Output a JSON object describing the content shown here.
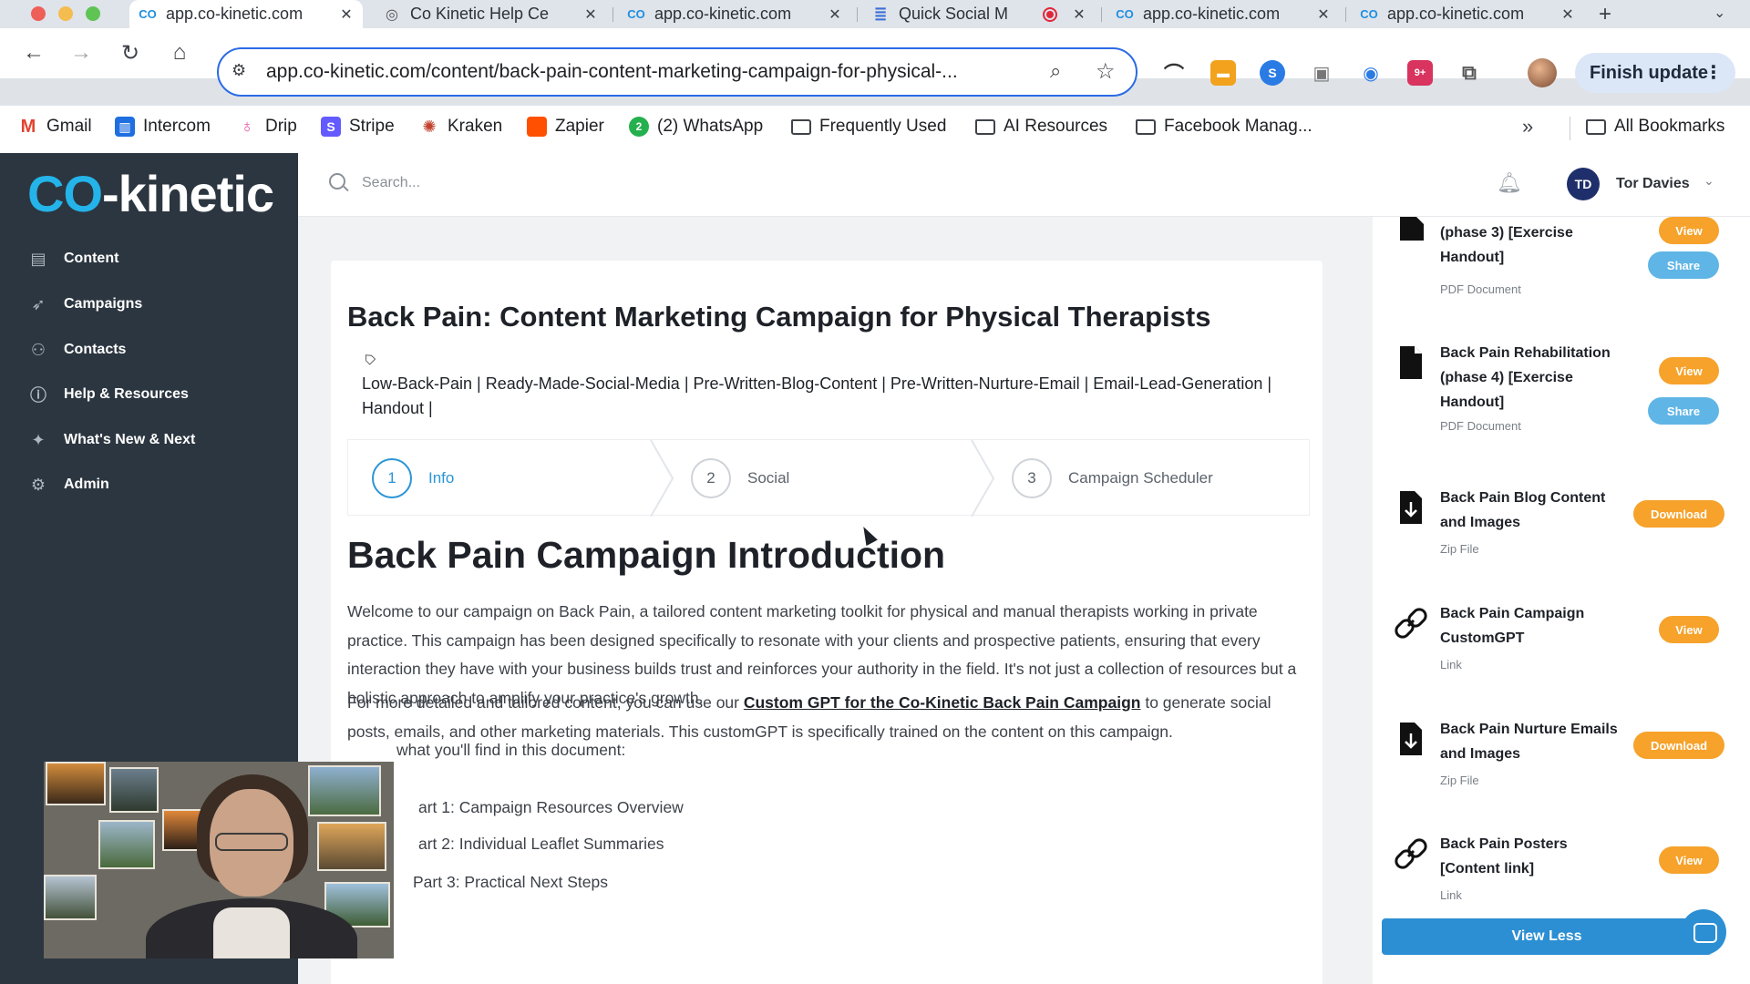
{
  "browser": {
    "tabs": [
      {
        "label": "app.co-kinetic.com",
        "active": true
      },
      {
        "label": "Co Kinetic Help Ce",
        "active": false
      },
      {
        "label": "app.co-kinetic.com",
        "active": false
      },
      {
        "label": "Quick Social M",
        "active": false
      },
      {
        "label": "app.co-kinetic.com",
        "active": false
      },
      {
        "label": "app.co-kinetic.com",
        "active": false
      }
    ],
    "url": "app.co-kinetic.com/content/back-pain-content-marketing-campaign-for-physical-...",
    "finish_update": "Finish update",
    "bookmarks": [
      "Gmail",
      "Intercom",
      "Drip",
      "Stripe",
      "Kraken",
      "Zapier",
      "(2) WhatsApp",
      "Frequently Used",
      "AI Resources",
      "Facebook Manag...",
      "All Bookmarks"
    ]
  },
  "app": {
    "logo_co": "CO",
    "logo_kinetic": "-kinetic",
    "nav": [
      "Content",
      "Campaigns",
      "Contacts",
      "Help & Resources",
      "What's New & Next",
      "Admin"
    ],
    "search_placeholder": "Search...",
    "user_name": "Tor Davies"
  },
  "content": {
    "title": "Back Pain: Content Marketing Campaign for Physical Therapists",
    "tags": "Low-Back-Pain | Ready-Made-Social-Media | Pre-Written-Blog-Content | Pre-Written-Nurture-Email | Email-Lead-Generation | Handout |",
    "steps": [
      {
        "num": "1",
        "label": "Info",
        "active": true
      },
      {
        "num": "2",
        "label": "Social",
        "active": false
      },
      {
        "num": "3",
        "label": "Campaign Scheduler",
        "active": false
      }
    ],
    "intro_heading": "Back Pain Campaign Introduction",
    "intro_para": "Welcome to our campaign on Back Pain, a tailored content marketing toolkit for physical and manual therapists working in private practice. This campaign has been designed specifically to resonate with your clients and prospective patients, ensuring that every interaction they have with your business builds trust and reinforces your authority in the field. It's not just a collection of resources but a holistic approach to amplify your practice's growth.",
    "para2_before": "For more detailed and tailored content, you can use our ",
    "para2_link": "Custom GPT for the Co-Kinetic Back Pain Campaign",
    "para2_after": " to generate social posts, emails, and other marketing materials. This customGPT is specifically trained on the content on this campaign.",
    "para3": "what you'll find in this document:",
    "list": [
      "art 1: Campaign Resources Overview",
      "art 2: Individual Leaflet Summaries",
      "Part 3: Practical Next Steps"
    ]
  },
  "resources": [
    {
      "title": "(phase 3) [Exercise Handout]",
      "type": "PDF Document",
      "icon": "pdf-icon",
      "buttons": [
        "View",
        "Share"
      ]
    },
    {
      "title": "Back Pain Rehabilitation (phase 4) [Exercise Handout]",
      "type": "PDF Document",
      "icon": "pdf-icon",
      "buttons": [
        "View",
        "Share"
      ]
    },
    {
      "title": "Back Pain Blog Content and Images",
      "type": "Zip File",
      "icon": "download-file-icon",
      "buttons": [
        "Download"
      ]
    },
    {
      "title": "Back Pain Campaign CustomGPT",
      "type": "Link",
      "icon": "link-icon",
      "buttons": [
        "View"
      ]
    },
    {
      "title": "Back Pain Nurture Emails and Images",
      "type": "Zip File",
      "icon": "download-file-icon",
      "buttons": [
        "Download"
      ]
    },
    {
      "title": "Back Pain Posters [Content link]",
      "type": "Link",
      "icon": "link-icon",
      "buttons": [
        "View"
      ]
    }
  ],
  "view_less": "View Less",
  "colors": {
    "sidebar": "#2c3640",
    "brand_blue": "#24b4ea",
    "view_orange": "#f6a22b",
    "share_blue": "#5fb5e6",
    "primary": "#2c8fd3"
  }
}
